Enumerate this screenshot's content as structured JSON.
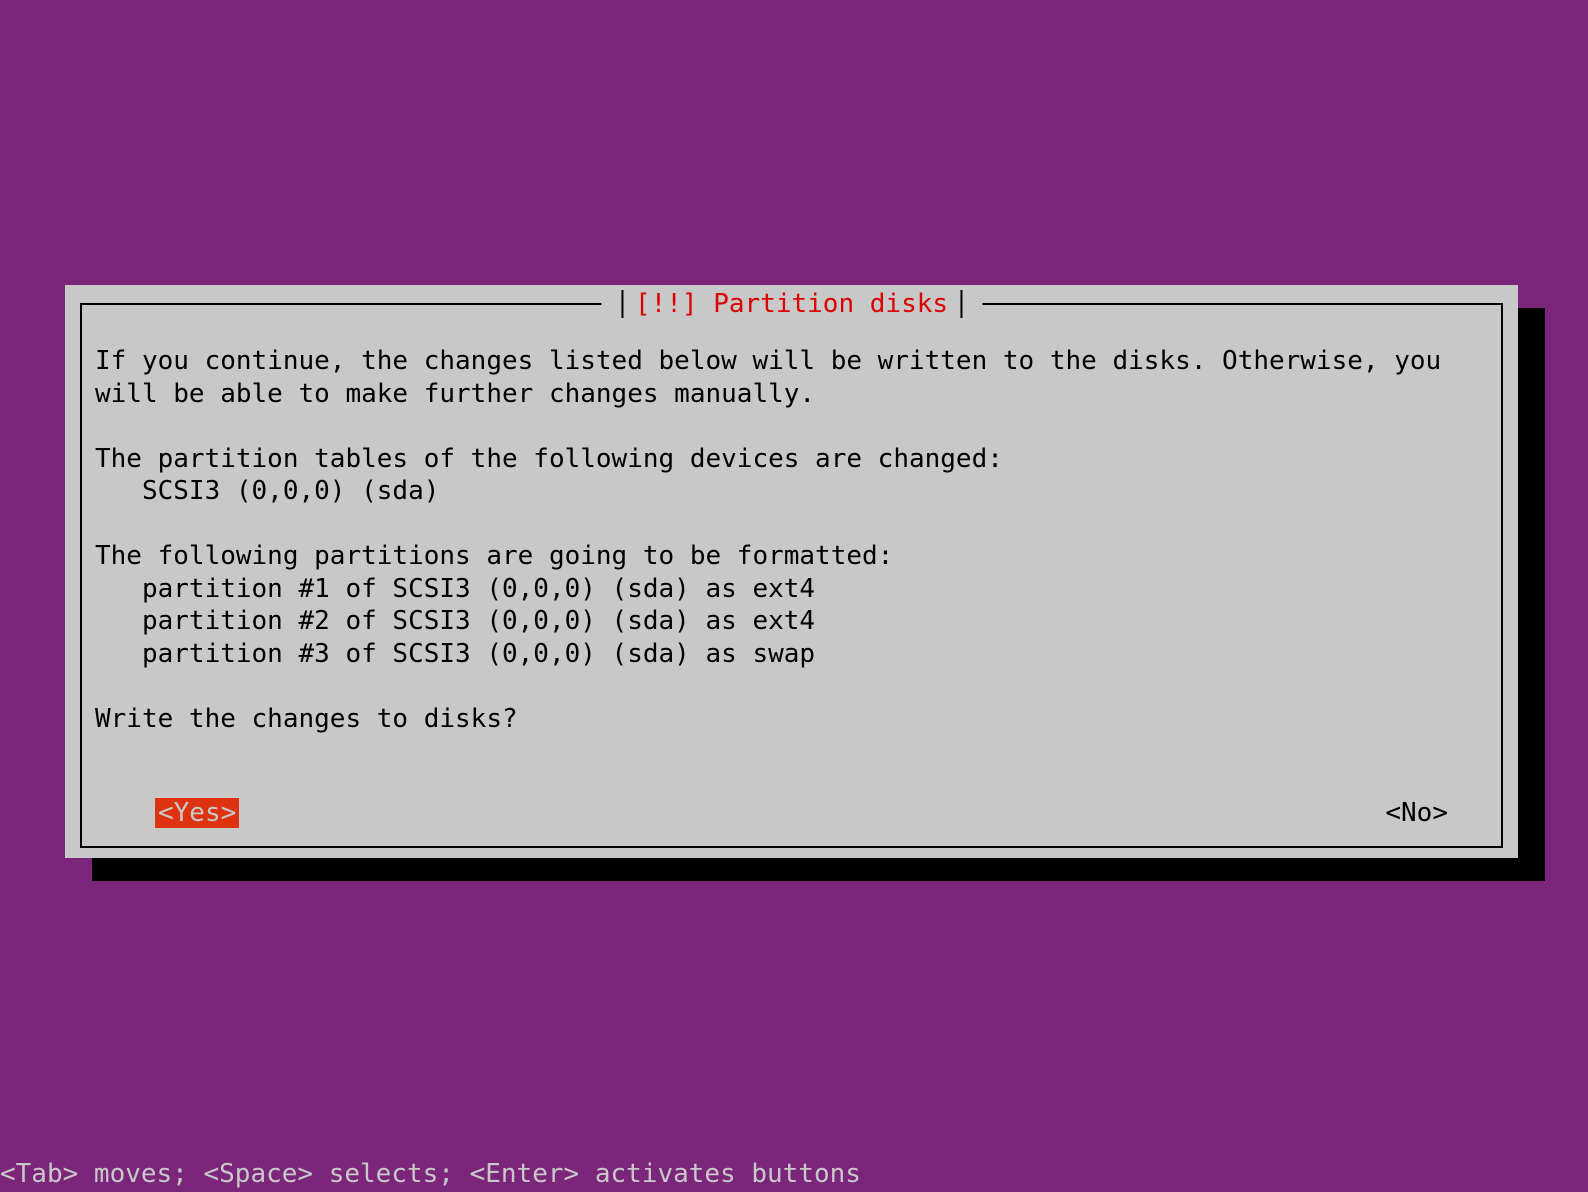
{
  "dialog": {
    "title": "[!!] Partition disks",
    "intro": "If you continue, the changes listed below will be written to the disks. Otherwise, you will be able to make further changes manually.",
    "devices_heading": "The partition tables of the following devices are changed:",
    "devices": [
      "SCSI3 (0,0,0) (sda)"
    ],
    "partitions_heading": "The following partitions are going to be formatted:",
    "partitions": [
      "partition #1 of SCSI3 (0,0,0) (sda) as ext4",
      "partition #2 of SCSI3 (0,0,0) (sda) as ext4",
      "partition #3 of SCSI3 (0,0,0) (sda) as swap"
    ],
    "question": "Write the changes to disks?",
    "yes_label": "<Yes>",
    "no_label": "<No>",
    "selected": "yes"
  },
  "footer": "<Tab> moves; <Space> selects; <Enter> activates buttons"
}
